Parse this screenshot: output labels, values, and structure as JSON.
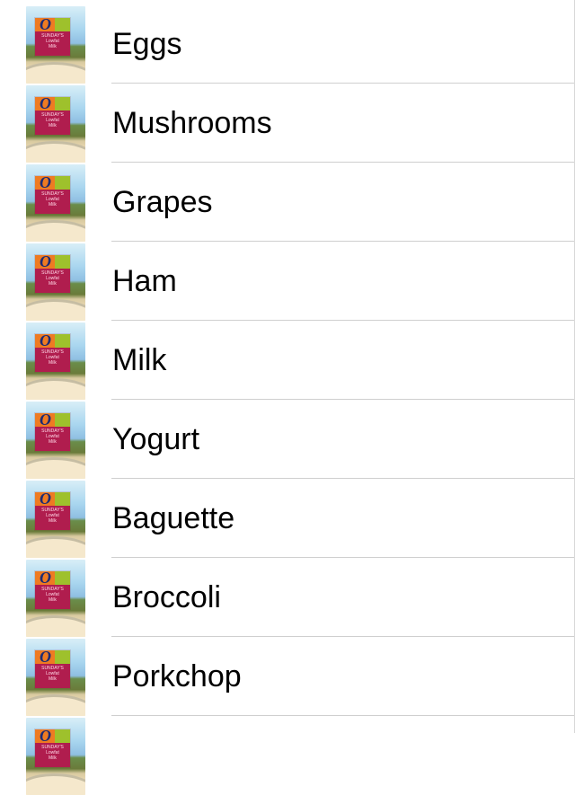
{
  "list": {
    "thumbnail_icon": "lowfat-milk-carton-photo",
    "thumbnail_text": [
      "SUNDAY'S",
      "Lowfat",
      "Milk"
    ],
    "items": [
      {
        "label": "Eggs"
      },
      {
        "label": "Mushrooms"
      },
      {
        "label": "Grapes"
      },
      {
        "label": "Ham"
      },
      {
        "label": "Milk"
      },
      {
        "label": "Yogurt"
      },
      {
        "label": "Baguette"
      },
      {
        "label": "Broccoli"
      },
      {
        "label": "Porkchop"
      },
      {
        "label": ""
      }
    ]
  },
  "colors": {
    "background": "#ffffff",
    "separator": "#cfcfcf",
    "text": "#000000"
  }
}
